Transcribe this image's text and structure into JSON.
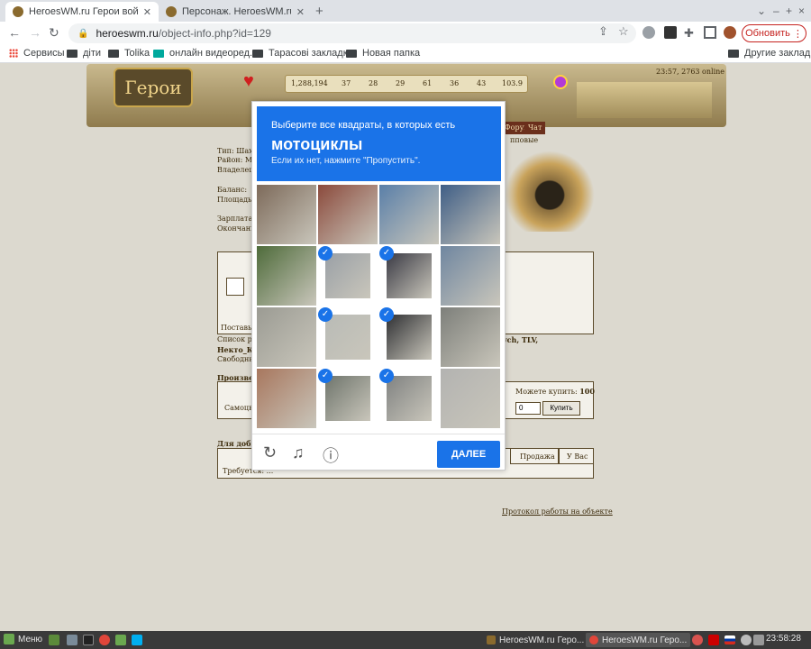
{
  "browser": {
    "tabs": [
      {
        "title": "HeroesWM.ru Герои войны и ...",
        "active": true
      },
      {
        "title": "Персонаж. HeroesWM.ru Герои...",
        "active": false
      }
    ],
    "window_controls": [
      "⌄",
      "–",
      "+",
      "×"
    ],
    "url_host": "heroeswm.ru",
    "url_path": "/object-info.php?id=129",
    "update_label": "Обновить",
    "bookmarks": [
      "Сервисы",
      "діти",
      "Tolika",
      "онлайн видеоред...",
      "Тарасові закладки",
      "Новая папка"
    ],
    "other_bookmarks": "Другие закладки"
  },
  "game": {
    "logo_text": "Герои",
    "resources": [
      "1,288,194",
      "37",
      "28",
      "29",
      "61",
      "36",
      "43",
      "103.9"
    ],
    "online": "23:57, 2763 online",
    "nav_links": [
      "Форум",
      "Чат"
    ],
    "subtitle_right": "пповые",
    "info": {
      "type": "Тип: Шахта",
      "district": "Район: Mi...",
      "owner": "Владелец:",
      "balance": "Баланс:",
      "area": "Площадь:",
      "salary": "Зарплата:",
      "ending": "Окончани..."
    },
    "supply_label": "Поставьте...",
    "list_prefix": "Список ра...",
    "list_suffix": "ych, TLV,",
    "necro": "Некто_К...",
    "free": "Свободны...",
    "production": "Произведе...",
    "can_buy_label": "Можете купить:",
    "can_buy_value": "100",
    "row_self": "Самоцв...",
    "buy_qty": "0",
    "buy_label": "Купить",
    "for_mining": "Для добы...",
    "col_sale": "Продажа",
    "col_have": "У Вас",
    "required": "Требуется: ...",
    "protocol_link": "Протокол работы на объекте"
  },
  "captcha": {
    "line1": "Выберите все квадраты, в которых есть",
    "line2": "мотоциклы",
    "line3": "Если их нет, нажмите \"Пропустить\".",
    "check_mark": "✓",
    "next_label": "ДАЛЕЕ",
    "icons": [
      "reload-icon",
      "audio-icon",
      "info-icon"
    ],
    "selected_tiles": [
      5,
      6,
      9,
      10,
      13,
      14
    ]
  },
  "taskbar": {
    "menu_label": "Меню",
    "windows": [
      "HeroesWM.ru Геро...",
      "HeroesWM.ru Геро..."
    ],
    "time": "23:58:28"
  }
}
